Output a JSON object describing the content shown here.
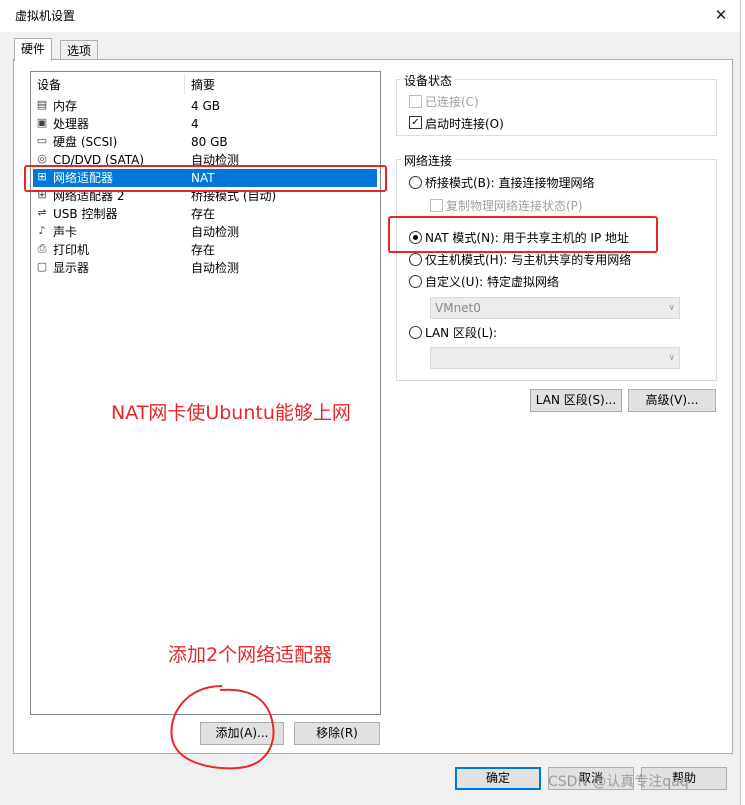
{
  "window": {
    "title": "虚拟机设置"
  },
  "tabs": [
    {
      "label": "硬件"
    },
    {
      "label": "选项"
    }
  ],
  "device_list": {
    "headers": {
      "device": "设备",
      "summary": "摘要"
    },
    "rows": [
      {
        "icon": "memory-icon",
        "name": "内存",
        "summary": "4 GB"
      },
      {
        "icon": "processor-icon",
        "name": "处理器",
        "summary": "4"
      },
      {
        "icon": "disk-icon",
        "name": "硬盘 (SCSI)",
        "summary": "80 GB"
      },
      {
        "icon": "cdrom-icon",
        "name": "CD/DVD (SATA)",
        "summary": "自动检测"
      },
      {
        "icon": "network-icon",
        "name": "网络适配器",
        "summary": "NAT"
      },
      {
        "icon": "network-icon",
        "name": "网络适配器 2",
        "summary": "桥接模式 (自动)"
      },
      {
        "icon": "usb-icon",
        "name": "USB 控制器",
        "summary": "存在"
      },
      {
        "icon": "sound-icon",
        "name": "声卡",
        "summary": "自动检测"
      },
      {
        "icon": "printer-icon",
        "name": "打印机",
        "summary": "存在"
      },
      {
        "icon": "display-icon",
        "name": "显示器",
        "summary": "自动检测"
      }
    ],
    "selected_index": 4
  },
  "device_status": {
    "title": "设备状态",
    "connected": {
      "label": "已连接(C)",
      "checked": false,
      "enabled": false
    },
    "connect_at_power_on": {
      "label": "启动时连接(O)",
      "checked": true
    }
  },
  "network_connection": {
    "title": "网络连接",
    "bridged": {
      "label": "桥接模式(B): 直接连接物理网络",
      "selected": false
    },
    "replicate": {
      "label": "复制物理网络连接状态(P)",
      "checked": false,
      "enabled": false
    },
    "nat": {
      "label": "NAT 模式(N): 用于共享主机的 IP 地址",
      "selected": true
    },
    "host_only": {
      "label": "仅主机模式(H): 与主机共享的专用网络",
      "selected": false
    },
    "custom": {
      "label": "自定义(U): 特定虚拟网络",
      "selected": false
    },
    "custom_select": {
      "value": "VMnet0"
    },
    "lan_segment": {
      "label": "LAN 区段(L):",
      "selected": false
    },
    "lan_select": {
      "value": ""
    }
  },
  "buttons": {
    "lan_segments": "LAN 区段(S)...",
    "advanced": "高级(V)...",
    "add": "添加(A)...",
    "remove": "移除(R)",
    "ok": "确定",
    "cancel": "取消",
    "help": "帮助"
  },
  "annotations": {
    "nat_note": "NAT网卡使Ubuntu能够上网",
    "add_note": "添加2个网络适配器",
    "color": "#e8262a"
  },
  "watermark": "CSDN @认真专注qaq",
  "colors": {
    "selection": "#0078d7",
    "dialog_bg": "#f0f0f0"
  }
}
